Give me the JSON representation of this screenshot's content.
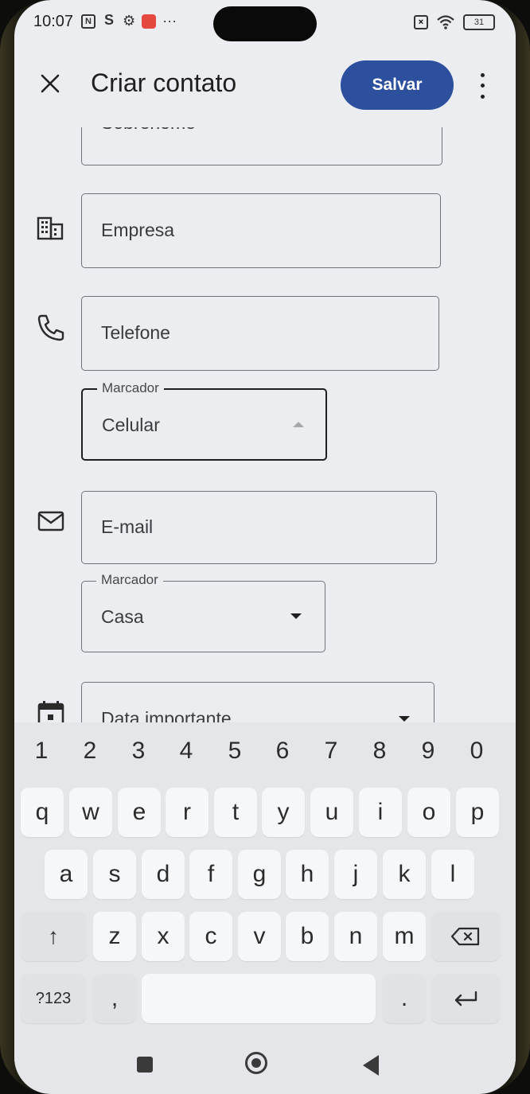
{
  "status_bar": {
    "time": "10:07",
    "battery": "31",
    "icons_left": [
      "nfc-icon",
      "s-icon",
      "settings-icon",
      "notification-icon",
      "more-dots"
    ],
    "icons_right": [
      "no-sim-icon",
      "wifi-icon",
      "battery-icon"
    ],
    "more_dots": "···"
  },
  "app_bar": {
    "title": "Criar contato",
    "save_label": "Salvar"
  },
  "form": {
    "surname_placeholder": "Sobrenome",
    "company_placeholder": "Empresa",
    "phone_placeholder": "Telefone",
    "phone_label_title": "Marcador",
    "phone_label_value": "Celular",
    "email_placeholder": "E-mail",
    "email_label_title": "Marcador",
    "email_label_value": "Casa",
    "date_placeholder": "Data importante"
  },
  "keyboard": {
    "numbers": [
      "1",
      "2",
      "3",
      "4",
      "5",
      "6",
      "7",
      "8",
      "9",
      "0"
    ],
    "row1": [
      "q",
      "w",
      "e",
      "r",
      "t",
      "y",
      "u",
      "i",
      "o",
      "p"
    ],
    "row2": [
      "a",
      "s",
      "d",
      "f",
      "g",
      "h",
      "j",
      "k",
      "l"
    ],
    "row3": [
      "z",
      "x",
      "c",
      "v",
      "b",
      "n",
      "m"
    ],
    "symbols_label": "?123",
    "comma": ",",
    "period": ".",
    "shift_glyph": "↑"
  },
  "colors": {
    "accent": "#2c4f9e",
    "background": "#ecedf1",
    "keyboard": "#e5e6ea"
  }
}
